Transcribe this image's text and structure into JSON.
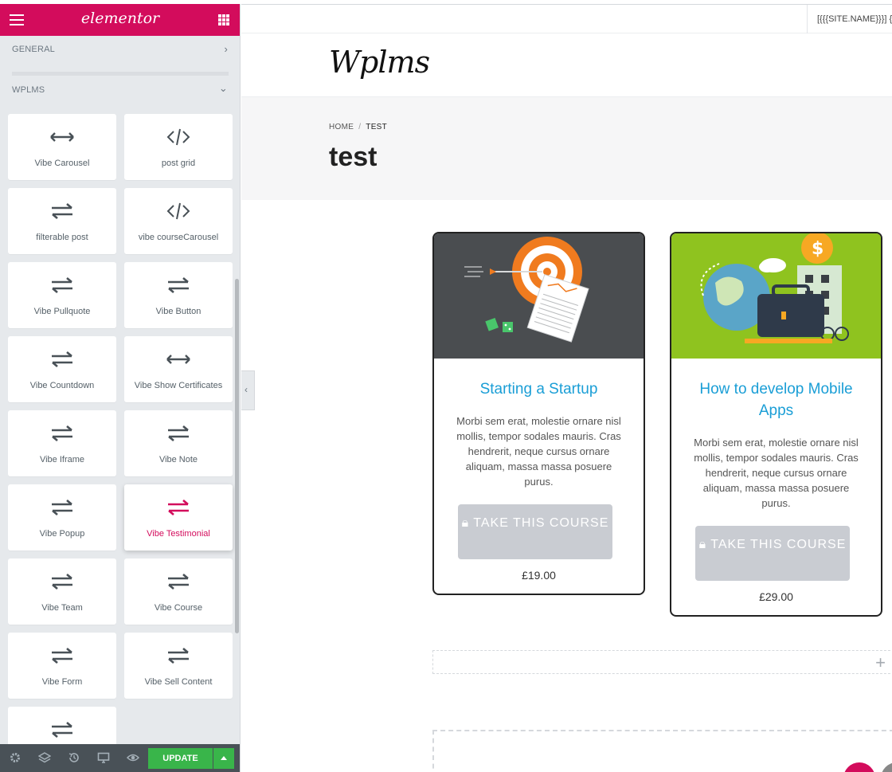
{
  "panel": {
    "brand": "elementor",
    "sections": [
      {
        "label": "GENERAL",
        "state": "collapsed"
      },
      {
        "label": "WPLMS",
        "state": "expanded"
      }
    ],
    "widgets": [
      {
        "label": "Vibe Carousel",
        "icon": "arrows-horizontal-icon"
      },
      {
        "label": "post grid",
        "icon": "code-icon"
      },
      {
        "label": "filterable post",
        "icon": "exchange-icon"
      },
      {
        "label": "vibe courseCarousel",
        "icon": "code-icon"
      },
      {
        "label": "Vibe Pullquote",
        "icon": "exchange-icon"
      },
      {
        "label": "Vibe Button",
        "icon": "exchange-icon"
      },
      {
        "label": "Vibe Countdown",
        "icon": "exchange-icon"
      },
      {
        "label": "Vibe Show Certificates",
        "icon": "arrows-horizontal-icon"
      },
      {
        "label": "Vibe Iframe",
        "icon": "exchange-icon"
      },
      {
        "label": "Vibe Note",
        "icon": "exchange-icon"
      },
      {
        "label": "Vibe Popup",
        "icon": "exchange-icon"
      },
      {
        "label": "Vibe Testimonial",
        "icon": "exchange-icon"
      },
      {
        "label": "Vibe Team",
        "icon": "exchange-icon"
      },
      {
        "label": "Vibe Course",
        "icon": "exchange-icon"
      },
      {
        "label": "Vibe Form",
        "icon": "exchange-icon"
      },
      {
        "label": "Vibe Sell Content",
        "icon": "exchange-icon"
      },
      {
        "label": "",
        "icon": "exchange-icon"
      }
    ],
    "active_widget": "Vibe Testimonial",
    "footer": {
      "update_label": "UPDATE",
      "icons": [
        "settings-icon",
        "layers-icon",
        "history-icon",
        "responsive-icon",
        "preview-eye-icon"
      ]
    }
  },
  "preview": {
    "topbar_site": "[{{{SITE.NAME}}}] {",
    "logo": "Wplms",
    "breadcrumb": {
      "home": "HOME",
      "separator": "/",
      "current": "TEST"
    },
    "page_title": "test",
    "courses": [
      {
        "title": "Starting a Startup",
        "description": "Morbi sem erat, molestie ornare nisl mollis, tempor sodales mauris. Cras hendrerit, neque cursus ornare aliquam, massa massa posuere purus.",
        "button": "TAKE THIS COURSE",
        "price": "£19.00"
      },
      {
        "title": "How to develop Mobile Apps",
        "description": "Morbi sem erat, molestie ornare nisl mollis, tempor sodales mauris. Cras hendrerit, neque cursus ornare aliquam, massa massa posuere purus.",
        "button": "TAKE THIS COURSE",
        "price": "£29.00"
      }
    ],
    "add_row_symbol": "+"
  },
  "colors": {
    "brand": "#d30c5c",
    "panel_bg": "#e6e9ec",
    "update_green": "#39b54a",
    "footer_bg": "#495157",
    "course_title": "#1a9ed6",
    "button_gray": "#c9ccd2",
    "card1_thumb": "#4a4d50",
    "card2_thumb": "#8fc31f"
  }
}
